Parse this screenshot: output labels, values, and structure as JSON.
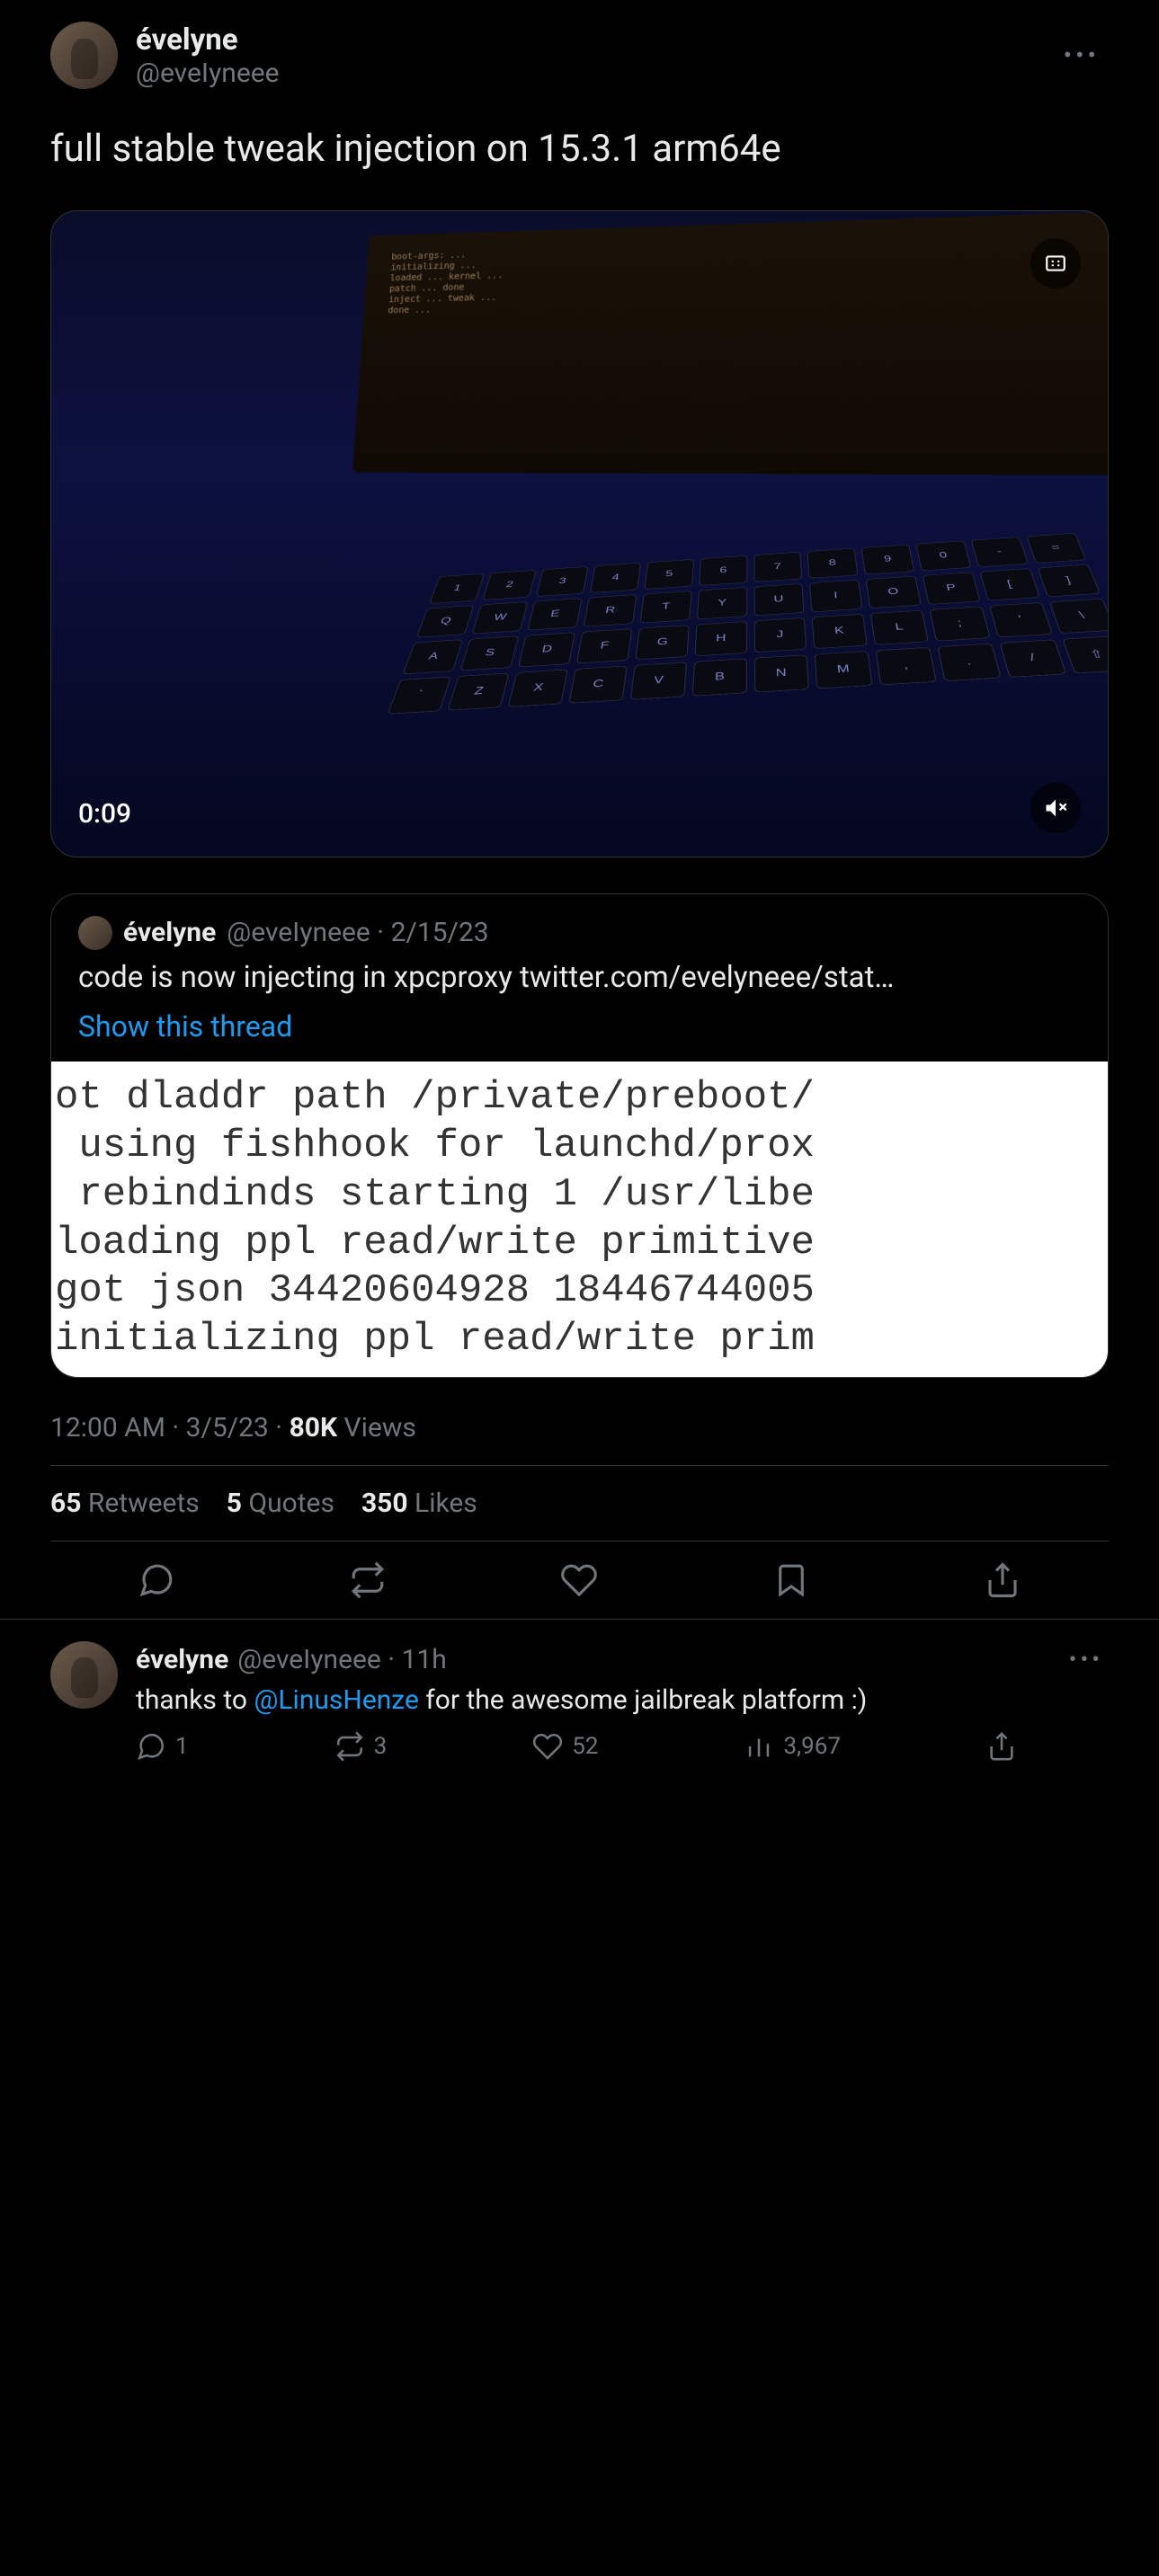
{
  "main": {
    "author": {
      "name": "évelyne",
      "handle": "@eveIyneee"
    },
    "text": "full stable tweak injection on 15.3.1 arm64e",
    "video": {
      "time": "0:09",
      "terminal_lines": [
        "boot-args: ...",
        "initializing ...",
        "loaded ... kernel ...",
        "patch ... done",
        "inject ... tweak ...",
        "done ..."
      ],
      "keys_row1": [
        "1",
        "2",
        "3",
        "4",
        "5",
        "6",
        "7",
        "8",
        "9",
        "0",
        "-",
        "="
      ],
      "keys_row2": [
        "q",
        "w",
        "e",
        "r",
        "t",
        "y",
        "u",
        "i",
        "o",
        "p",
        "[",
        "]"
      ],
      "keys_row3": [
        "a",
        "s",
        "d",
        "f",
        "g",
        "h",
        "j",
        "k",
        "l",
        ";",
        "'",
        "\\"
      ],
      "keys_row4": [
        "`",
        "z",
        "x",
        "c",
        "v",
        "b",
        "n",
        "m",
        ",",
        ".",
        "/",
        "⇧"
      ]
    },
    "quoted": {
      "author": {
        "name": "évelyne",
        "handle": "@eveIyneee"
      },
      "date": "2/15/23",
      "body": "code is now injecting in xpcproxy twitter.com/evelyneee/stat…",
      "show_thread": "Show this thread",
      "image_text": "ot dladdr path /private/preboot/\n using fishhook for launchd/prox\n rebindinds starting 1 /usr/libe\nloading ppl read/write primitive\ngot json 34420604928 18446744005\ninitializing ppl read/write prim"
    },
    "meta": {
      "time": "12:00 AM",
      "date": "3/5/23",
      "views_count": "80K",
      "views_label": "Views"
    },
    "stats": {
      "retweets_count": "65",
      "retweets_label": "Retweets",
      "quotes_count": "5",
      "quotes_label": "Quotes",
      "likes_count": "350",
      "likes_label": "Likes"
    }
  },
  "reply": {
    "author": {
      "name": "évelyne",
      "handle": "@eveIyneee"
    },
    "age": "11h",
    "text_pre": "thanks to ",
    "mention": "@LinusHenze",
    "text_post": " for the awesome jailbreak platform :)",
    "metrics": {
      "replies": "1",
      "retweets": "3",
      "likes": "52",
      "views": "3,967"
    }
  }
}
